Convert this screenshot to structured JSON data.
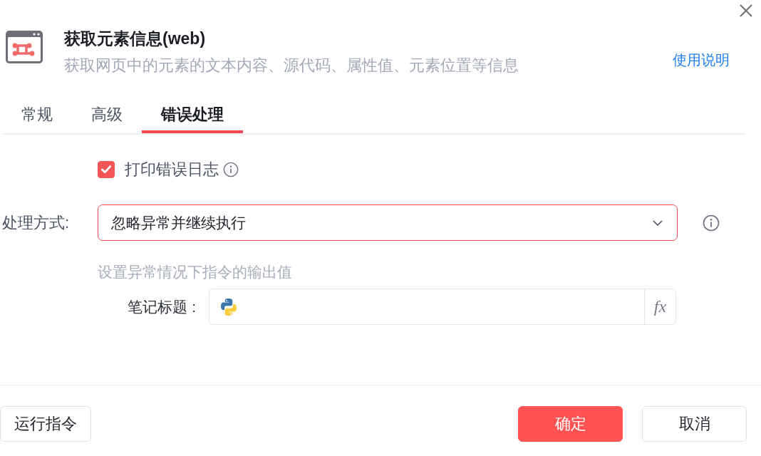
{
  "dialog": {
    "title": "获取元素信息(web)",
    "description": "获取网页中的元素的文本内容、源代码、属性值、元素位置等信息",
    "help_link": "使用说明"
  },
  "tabs": [
    {
      "label": "常规",
      "selected": false
    },
    {
      "label": "高级",
      "selected": false
    },
    {
      "label": "错误处理",
      "selected": true
    }
  ],
  "error_handling": {
    "print_error_log": {
      "label": "打印错误日志",
      "checked": true
    },
    "handling_mode": {
      "label": "处理方式:",
      "value": "忽略异常并继续执行"
    },
    "output_values": {
      "title": "设置异常情况下指令的输出值",
      "fields": [
        {
          "label": "笔记标题 :",
          "formula_button": "fx"
        }
      ]
    }
  },
  "footer": {
    "left_buttons": [
      {
        "label": "运行指令",
        "kind": "default"
      }
    ],
    "right_buttons": [
      {
        "label": "确定",
        "kind": "primary"
      },
      {
        "label": "取消",
        "kind": "default"
      }
    ]
  }
}
